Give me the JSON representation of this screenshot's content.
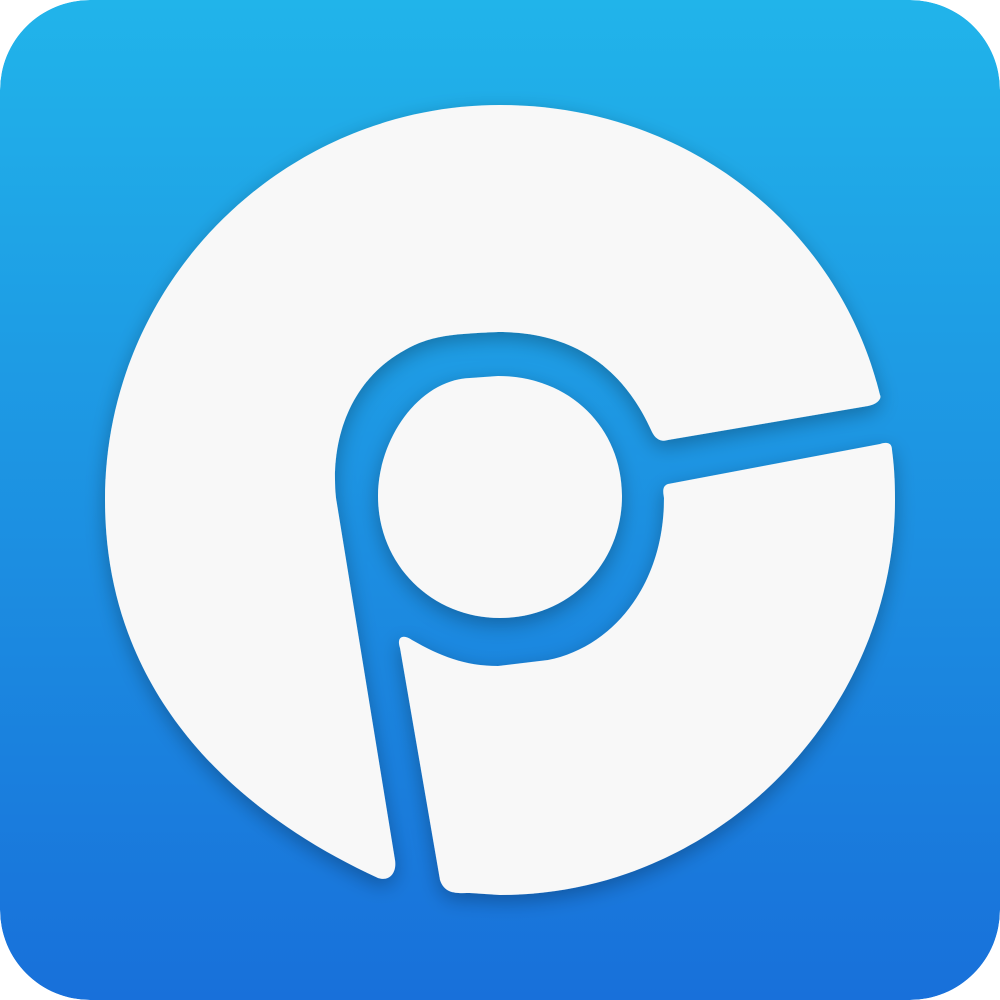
{
  "icon": {
    "name": "browser-logo-icon",
    "colors": {
      "gradient_top": "#21b4ea",
      "gradient_bottom": "#1870da",
      "glyph": "#f8f8f8"
    }
  }
}
